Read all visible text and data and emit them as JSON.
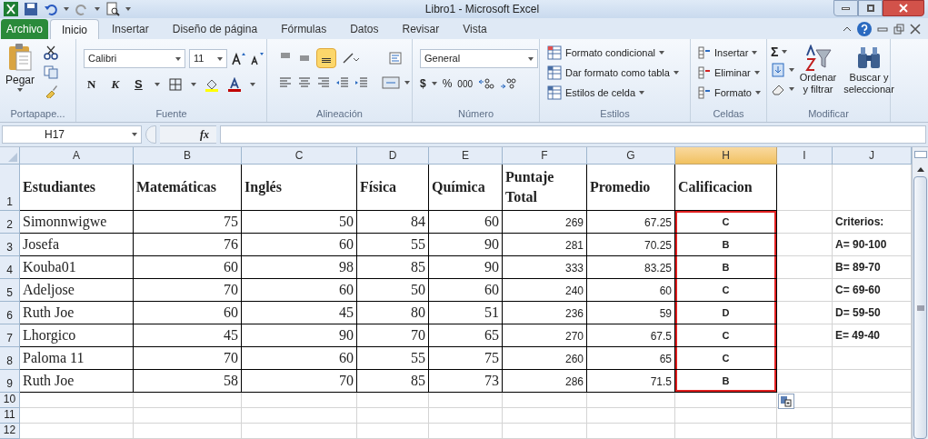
{
  "window": {
    "title": "Libro1  -  Microsoft Excel"
  },
  "file_tab": {
    "label": "Archivo"
  },
  "tabs": [
    {
      "label": "Inicio",
      "selected": true
    },
    {
      "label": "Insertar",
      "selected": false
    },
    {
      "label": "Diseño de página",
      "selected": false
    },
    {
      "label": "Fórmulas",
      "selected": false
    },
    {
      "label": "Datos",
      "selected": false
    },
    {
      "label": "Revisar",
      "selected": false
    },
    {
      "label": "Vista",
      "selected": false
    }
  ],
  "ribbon": {
    "groups": [
      {
        "kind": "clipboard",
        "label": "Portapape...",
        "paste": "Pegar"
      },
      {
        "kind": "font",
        "label": "Fuente",
        "font": "Calibri",
        "size": "11",
        "bold": "N",
        "italic": "K",
        "underline": "S"
      },
      {
        "kind": "alignment",
        "label": "Alineación",
        "middle_align_selected": true
      },
      {
        "kind": "number",
        "label": "Número",
        "format": "General",
        "currency": "$",
        "percent": "%",
        "thousands": "000"
      },
      {
        "kind": "styles",
        "label": "Estilos",
        "items": [
          "Formato condicional",
          "Dar formato como tabla",
          "Estilos de celda"
        ]
      },
      {
        "kind": "cells",
        "label": "Celdas",
        "items": [
          "Insertar",
          "Eliminar",
          "Formato"
        ]
      },
      {
        "kind": "editing",
        "label": "Modificar",
        "sum": "Σ",
        "sort": [
          "Ordenar",
          "y filtrar"
        ],
        "find": [
          "Buscar y",
          "seleccionar"
        ]
      }
    ]
  },
  "name_box": {
    "value": "H17"
  },
  "formula_bar": {
    "fx": "fx"
  },
  "columns": [
    {
      "label": "A",
      "selected": false
    },
    {
      "label": "B",
      "selected": false
    },
    {
      "label": "C",
      "selected": false
    },
    {
      "label": "D",
      "selected": false
    },
    {
      "label": "E",
      "selected": false
    },
    {
      "label": "F",
      "selected": false
    },
    {
      "label": "G",
      "selected": false
    },
    {
      "label": "H",
      "selected": true
    },
    {
      "label": "I",
      "selected": false
    },
    {
      "label": "J",
      "selected": false
    }
  ],
  "rows": [
    {
      "number": "1",
      "cells": [
        {
          "kind": "header",
          "text": "Estudiantes"
        },
        {
          "kind": "header",
          "text": "Matemáticas"
        },
        {
          "kind": "header",
          "text": "Inglés"
        },
        {
          "kind": "header",
          "text": "Física"
        },
        {
          "kind": "header",
          "text": "Química"
        },
        {
          "kind": "header",
          "text": "Puntaje Total"
        },
        {
          "kind": "header",
          "text": "Promedio"
        },
        {
          "kind": "header",
          "text": "Calificacion"
        },
        {
          "kind": "empty"
        },
        {
          "kind": "empty"
        }
      ]
    },
    {
      "number": "2",
      "cells": [
        {
          "kind": "name",
          "text": "Simonnwigwe"
        },
        {
          "kind": "score",
          "text": "75"
        },
        {
          "kind": "score",
          "text": "50"
        },
        {
          "kind": "score",
          "text": "84"
        },
        {
          "kind": "score",
          "text": "60"
        },
        {
          "kind": "total",
          "text": "269"
        },
        {
          "kind": "total",
          "text": "67.25"
        },
        {
          "kind": "grade",
          "text": "C",
          "outlined": true
        },
        {
          "kind": "empty"
        },
        {
          "kind": "note",
          "text": "Criterios:"
        }
      ]
    },
    {
      "number": "3",
      "cells": [
        {
          "kind": "name",
          "text": "Josefa"
        },
        {
          "kind": "score",
          "text": "76"
        },
        {
          "kind": "score",
          "text": "60"
        },
        {
          "kind": "score",
          "text": "55"
        },
        {
          "kind": "score",
          "text": "90"
        },
        {
          "kind": "total",
          "text": "281"
        },
        {
          "kind": "total",
          "text": "70.25"
        },
        {
          "kind": "grade",
          "text": "B",
          "outlined": true
        },
        {
          "kind": "empty"
        },
        {
          "kind": "note",
          "text": "A= 90-100"
        }
      ]
    },
    {
      "number": "4",
      "cells": [
        {
          "kind": "name",
          "text": "Kouba01"
        },
        {
          "kind": "score",
          "text": "60"
        },
        {
          "kind": "score",
          "text": "98"
        },
        {
          "kind": "score",
          "text": "85"
        },
        {
          "kind": "score",
          "text": "90"
        },
        {
          "kind": "total",
          "text": "333"
        },
        {
          "kind": "total",
          "text": "83.25"
        },
        {
          "kind": "grade",
          "text": "B",
          "outlined": true
        },
        {
          "kind": "empty"
        },
        {
          "kind": "note",
          "text": "B= 89-70"
        }
      ]
    },
    {
      "number": "5",
      "cells": [
        {
          "kind": "name",
          "text": "Adeljose"
        },
        {
          "kind": "score",
          "text": "70"
        },
        {
          "kind": "score",
          "text": "60"
        },
        {
          "kind": "score",
          "text": "50"
        },
        {
          "kind": "score",
          "text": "60"
        },
        {
          "kind": "total",
          "text": "240"
        },
        {
          "kind": "total",
          "text": "60"
        },
        {
          "kind": "grade",
          "text": "C",
          "outlined": true
        },
        {
          "kind": "empty"
        },
        {
          "kind": "note",
          "text": "C= 69-60"
        }
      ]
    },
    {
      "number": "6",
      "cells": [
        {
          "kind": "name",
          "text": "Ruth Joe"
        },
        {
          "kind": "score",
          "text": "60"
        },
        {
          "kind": "score",
          "text": "45"
        },
        {
          "kind": "score",
          "text": "80"
        },
        {
          "kind": "score",
          "text": "51"
        },
        {
          "kind": "total",
          "text": "236"
        },
        {
          "kind": "total",
          "text": "59"
        },
        {
          "kind": "grade",
          "text": "D",
          "outlined": true
        },
        {
          "kind": "empty"
        },
        {
          "kind": "note",
          "text": "D= 59-50"
        }
      ]
    },
    {
      "number": "7",
      "cells": [
        {
          "kind": "name",
          "text": "Lhorgico"
        },
        {
          "kind": "score",
          "text": "45"
        },
        {
          "kind": "score",
          "text": "90"
        },
        {
          "kind": "score",
          "text": "70"
        },
        {
          "kind": "score",
          "text": "65"
        },
        {
          "kind": "total",
          "text": "270"
        },
        {
          "kind": "total",
          "text": "67.5"
        },
        {
          "kind": "grade",
          "text": "C",
          "outlined": true
        },
        {
          "kind": "empty"
        },
        {
          "kind": "note",
          "text": "E= 49-40"
        }
      ]
    },
    {
      "number": "8",
      "cells": [
        {
          "kind": "name",
          "text": "Paloma 11"
        },
        {
          "kind": "score",
          "text": "70"
        },
        {
          "kind": "score",
          "text": "60"
        },
        {
          "kind": "score",
          "text": "55"
        },
        {
          "kind": "score",
          "text": "75"
        },
        {
          "kind": "total",
          "text": "260"
        },
        {
          "kind": "total",
          "text": "65"
        },
        {
          "kind": "grade",
          "text": "C",
          "outlined": true
        },
        {
          "kind": "empty"
        },
        {
          "kind": "empty"
        }
      ]
    },
    {
      "number": "9",
      "cells": [
        {
          "kind": "name",
          "text": "Ruth Joe"
        },
        {
          "kind": "score",
          "text": "58"
        },
        {
          "kind": "score",
          "text": "70"
        },
        {
          "kind": "score",
          "text": "85"
        },
        {
          "kind": "score",
          "text": "73"
        },
        {
          "kind": "total",
          "text": "286"
        },
        {
          "kind": "total",
          "text": "71.5"
        },
        {
          "kind": "grade",
          "text": "B",
          "outlined": true
        },
        {
          "kind": "empty"
        },
        {
          "kind": "empty"
        }
      ]
    },
    {
      "number": "10",
      "cells": [],
      "paste_options": true
    },
    {
      "number": "11",
      "cells": []
    },
    {
      "number": "12",
      "cells": []
    }
  ]
}
